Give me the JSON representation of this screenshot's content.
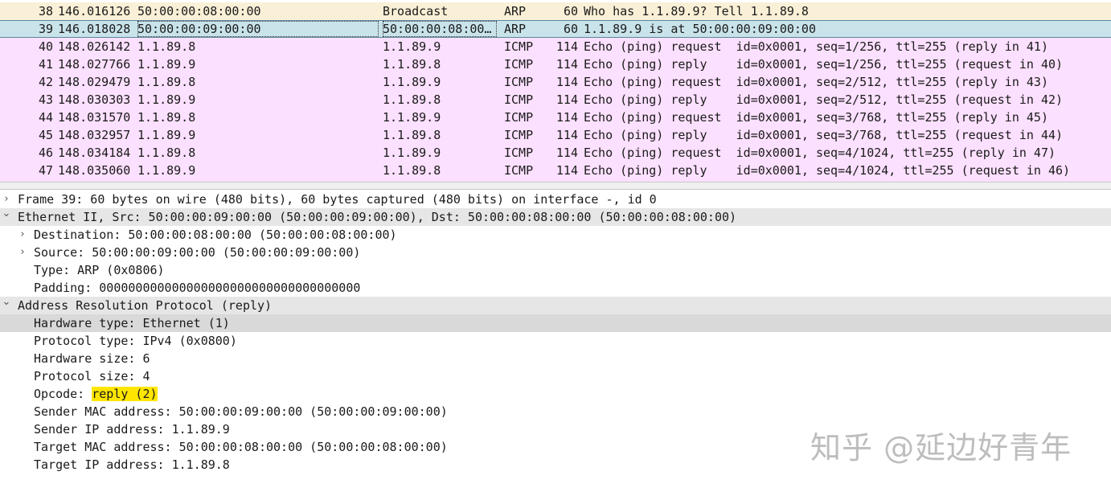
{
  "packet_list": {
    "rows": [
      {
        "no": "38",
        "time": "146.016126",
        "src": "50:00:00:08:00:00",
        "dst": "Broadcast",
        "proto": "ARP",
        "len": "60",
        "info": "Who has 1.1.89.9? Tell 1.1.89.8",
        "color": "arp",
        "selected": false
      },
      {
        "no": "39",
        "time": "146.018028",
        "src": "50:00:00:09:00:00",
        "dst": "50:00:00:08:00…",
        "proto": "ARP",
        "len": "60",
        "info": "1.1.89.9 is at 50:00:00:09:00:00",
        "color": "arp",
        "selected": true
      },
      {
        "no": "40",
        "time": "148.026142",
        "src": "1.1.89.8",
        "dst": "1.1.89.9",
        "proto": "ICMP",
        "len": "114",
        "info": "Echo (ping) request  id=0x0001, seq=1/256, ttl=255 (reply in 41)",
        "color": "icmp",
        "selected": false
      },
      {
        "no": "41",
        "time": "148.027766",
        "src": "1.1.89.9",
        "dst": "1.1.89.8",
        "proto": "ICMP",
        "len": "114",
        "info": "Echo (ping) reply    id=0x0001, seq=1/256, ttl=255 (request in 40)",
        "color": "icmp",
        "selected": false
      },
      {
        "no": "42",
        "time": "148.029479",
        "src": "1.1.89.8",
        "dst": "1.1.89.9",
        "proto": "ICMP",
        "len": "114",
        "info": "Echo (ping) request  id=0x0001, seq=2/512, ttl=255 (reply in 43)",
        "color": "icmp",
        "selected": false
      },
      {
        "no": "43",
        "time": "148.030303",
        "src": "1.1.89.9",
        "dst": "1.1.89.8",
        "proto": "ICMP",
        "len": "114",
        "info": "Echo (ping) reply    id=0x0001, seq=2/512, ttl=255 (request in 42)",
        "color": "icmp",
        "selected": false
      },
      {
        "no": "44",
        "time": "148.031570",
        "src": "1.1.89.8",
        "dst": "1.1.89.9",
        "proto": "ICMP",
        "len": "114",
        "info": "Echo (ping) request  id=0x0001, seq=3/768, ttl=255 (reply in 45)",
        "color": "icmp",
        "selected": false
      },
      {
        "no": "45",
        "time": "148.032957",
        "src": "1.1.89.9",
        "dst": "1.1.89.8",
        "proto": "ICMP",
        "len": "114",
        "info": "Echo (ping) reply    id=0x0001, seq=3/768, ttl=255 (request in 44)",
        "color": "icmp",
        "selected": false
      },
      {
        "no": "46",
        "time": "148.034184",
        "src": "1.1.89.8",
        "dst": "1.1.89.9",
        "proto": "ICMP",
        "len": "114",
        "info": "Echo (ping) request  id=0x0001, seq=4/1024, ttl=255 (reply in 47)",
        "color": "icmp",
        "selected": false
      },
      {
        "no": "47",
        "time": "148.035060",
        "src": "1.1.89.9",
        "dst": "1.1.89.8",
        "proto": "ICMP",
        "len": "114",
        "info": "Echo (ping) reply    id=0x0001, seq=4/1024, ttl=255 (request in 46)",
        "color": "icmp",
        "selected": false
      }
    ]
  },
  "details": [
    {
      "text": "Frame 39: 60 bytes on wire (480 bits), 60 bytes captured (480 bits) on interface -, id 0",
      "arrow": "collapsed",
      "level": 0
    },
    {
      "text": "Ethernet II, Src: 50:00:00:09:00:00 (50:00:00:09:00:00), Dst: 50:00:00:08:00:00 (50:00:00:08:00:00)",
      "arrow": "expanded",
      "level": 0,
      "highlight": true
    },
    {
      "text": "Destination: 50:00:00:08:00:00 (50:00:00:08:00:00)",
      "arrow": "collapsed",
      "level": 1
    },
    {
      "text": "Source: 50:00:00:09:00:00 (50:00:00:09:00:00)",
      "arrow": "collapsed",
      "level": 1
    },
    {
      "text": "Type: ARP (0x0806)",
      "arrow": "none",
      "level": 1
    },
    {
      "text": "Padding: 000000000000000000000000000000000000",
      "arrow": "none",
      "level": 1
    },
    {
      "text": "Address Resolution Protocol (reply)",
      "arrow": "expanded",
      "level": 0,
      "highlight": true
    },
    {
      "text": "Hardware type: Ethernet (1)",
      "arrow": "none",
      "level": 1,
      "selected": true
    },
    {
      "text": "Protocol type: IPv4 (0x0800)",
      "arrow": "none",
      "level": 1
    },
    {
      "text": "Hardware size: 6",
      "arrow": "none",
      "level": 1
    },
    {
      "text": "Protocol size: 4",
      "arrow": "none",
      "level": 1
    },
    {
      "text": "Opcode: ",
      "text_highlight": "reply (2)",
      "arrow": "none",
      "level": 1
    },
    {
      "text": "Sender MAC address: 50:00:00:09:00:00 (50:00:00:09:00:00)",
      "arrow": "none",
      "level": 1
    },
    {
      "text": "Sender IP address: 1.1.89.9",
      "arrow": "none",
      "level": 1
    },
    {
      "text": "Target MAC address: 50:00:00:08:00:00 (50:00:00:08:00:00)",
      "arrow": "none",
      "level": 1
    },
    {
      "text": "Target IP address: 1.1.89.8",
      "arrow": "none",
      "level": 1
    }
  ],
  "watermark": "知乎 @延边好青年",
  "icons": {
    "collapsed": "chevron-right-icon",
    "expanded": "chevron-down-icon"
  },
  "colors": {
    "arp_row": "#faf0d7",
    "icmp_row": "#fce0ff",
    "selected_row": "#c9e3ea",
    "opcode_highlight": "#ffe600"
  }
}
